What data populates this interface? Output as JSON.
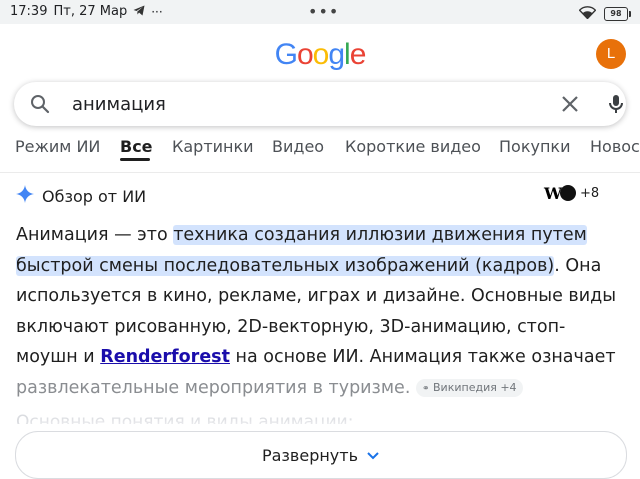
{
  "status_bar": {
    "time": "17:39",
    "date": "Пт, 27 Мар",
    "more": "···",
    "battery": "98"
  },
  "header": {
    "logo_letters": [
      {
        "ch": "G",
        "color": "#4285F4"
      },
      {
        "ch": "o",
        "color": "#EA4335"
      },
      {
        "ch": "o",
        "color": "#FBBC05"
      },
      {
        "ch": "g",
        "color": "#4285F4"
      },
      {
        "ch": "l",
        "color": "#34A853"
      },
      {
        "ch": "e",
        "color": "#EA4335"
      }
    ],
    "avatar_letter": "L",
    "avatar_color": "#e8710a"
  },
  "search": {
    "value": "анимация"
  },
  "tabs": [
    {
      "label": "Режим ИИ",
      "active": false
    },
    {
      "label": "Все",
      "active": true
    },
    {
      "label": "Картинки",
      "active": false
    },
    {
      "label": "Видео",
      "active": false
    },
    {
      "label": "Короткие видео",
      "active": false
    },
    {
      "label": "Покупки",
      "active": false
    },
    {
      "label": "Новост",
      "active": false
    }
  ],
  "ai_overview": {
    "title": "Обзор от ИИ",
    "source_icon_letter": "W",
    "sources_more": "+8",
    "text_intro": "Анимация — это ",
    "text_highlight_1": "техника создания иллюзии движения путем",
    "text_highlight_2": "быстрой смены последовательных изображений (кадров)",
    "text_middle": ". Она используется в кино, рекламе, играх и дизайне. Основные виды включают рисованную, 2D-векторную, 3D-анимацию, стоп-моушн и ",
    "link_text": "Renderforest",
    "text_after_link": " на основе ИИ. Анимация также означает ",
    "text_faded": "развлекательные мероприятия в туризме.",
    "citation_chip": "Википедия +4",
    "next_heading": "Основные понятия и виды анимации:",
    "expand_label": "Развернуть"
  },
  "colors": {
    "highlight": "#d3e3fd",
    "link": "#1a0dab",
    "ai_spark_blue": "#4285F4"
  }
}
